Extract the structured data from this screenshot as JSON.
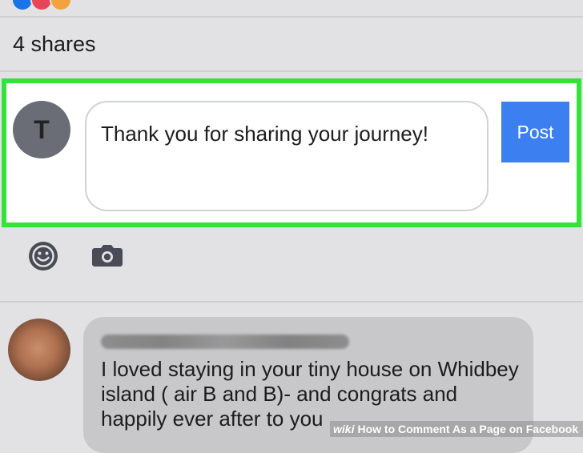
{
  "post_meta": {
    "shares_label": "4 shares"
  },
  "composer": {
    "avatar_initial": "T",
    "comment_text": "Thank you for sharing your journey!",
    "post_label": "Post",
    "highlight_color": "#35e23a",
    "accent_color": "#3b7ff0"
  },
  "toolbar": {
    "icons": [
      "smiley-icon",
      "camera-icon"
    ]
  },
  "reply": {
    "text": "I loved staying in your tiny house on Whidbey island ( air B and B)- and congrats and happily ever after to you"
  },
  "watermark": {
    "brand": "wiki",
    "text": "How to Comment As a Page on Facebook"
  }
}
